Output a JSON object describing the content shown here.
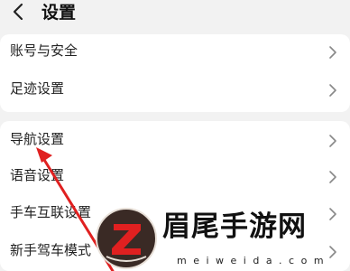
{
  "header": {
    "back_icon": "chevron-left-icon",
    "title": "设置"
  },
  "group1": {
    "items": [
      {
        "label": "账号与安全"
      },
      {
        "label": "足迹设置"
      }
    ]
  },
  "group2": {
    "items": [
      {
        "label": "导航设置"
      },
      {
        "label": "语音设置"
      },
      {
        "label": "手车互联设置"
      },
      {
        "label": "新手驾车模式"
      }
    ]
  },
  "annotation": {
    "arrow_color": "#e02020"
  },
  "watermark": {
    "text": "眉尾手游网",
    "url": "m e i w e i d a . c o m"
  },
  "colors": {
    "background": "#f2f2f2",
    "card": "#ffffff",
    "text": "#222222",
    "chevron": "#999999"
  }
}
